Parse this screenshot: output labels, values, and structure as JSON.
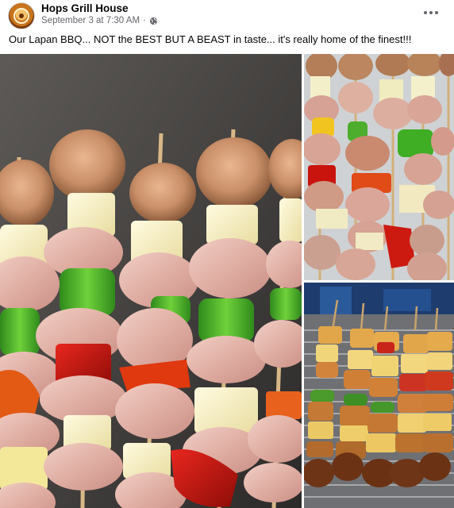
{
  "post": {
    "page_name": "Hops Grill House",
    "date": "September 3 at 7:30 AM",
    "separator": "·",
    "audience_icon": "globe-icon",
    "more_icon": "more-options-icon",
    "caption": "Our Lapan BBQ... NOT the BEST BUT A BEAST in taste... it's really home of the finest!!!"
  },
  "photos": [
    {
      "subject": "raw chicken, pineapple and pepper skewers close-up"
    },
    {
      "subject": "raw skewers on tray"
    },
    {
      "subject": "skewers grilling on charcoal grill"
    }
  ],
  "colors": {
    "text_primary": "#050505",
    "text_secondary": "#65676b",
    "background": "#ffffff"
  }
}
